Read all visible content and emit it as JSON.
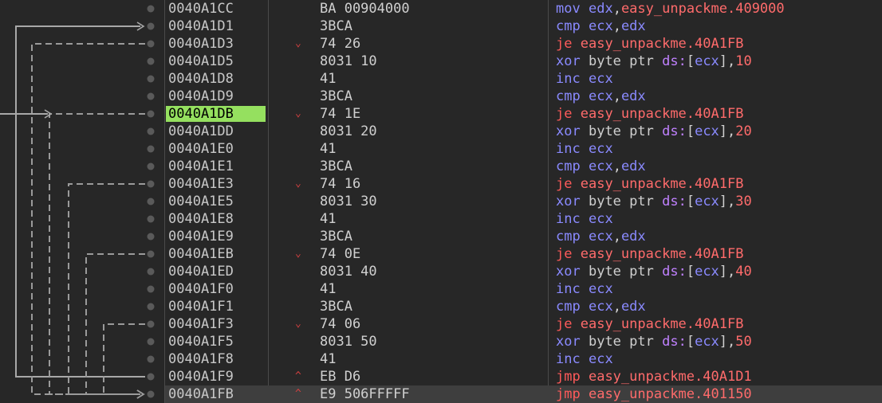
{
  "colors": {
    "background": "#272727",
    "current_row": "#3e3e3e",
    "highlight_address": "#95e05f",
    "arrow": "#9a9a9a",
    "mnemonic_jump": "#ff5a5a",
    "mnemonic_other": "#8a8aff",
    "register": "#8a8aff",
    "label_and_number": "#ff6b6b",
    "segment": "#c081ff"
  },
  "rows": [
    {
      "addr": "0040A1CC",
      "bytes": "BA 00904000",
      "jmark": "",
      "mnemonic": "mov",
      "op_a": "edx",
      "sep": ",",
      "op_b": "easy_unpackme.409000",
      "op_b_kind": "lbl",
      "tail": ""
    },
    {
      "addr": "0040A1D1",
      "bytes": "3BCA",
      "jmark": "",
      "mnemonic": "cmp",
      "op_a": "ecx",
      "sep": ",",
      "op_b": "edx",
      "op_b_kind": "reg",
      "tail": ""
    },
    {
      "addr": "0040A1D3",
      "bytes": "74 26",
      "jmark": "⌄",
      "mnemonic": "je",
      "op_a": "easy_unpackme.40A1FB",
      "sep": "",
      "op_b": "",
      "op_b_kind": "",
      "tail": ""
    },
    {
      "addr": "0040A1D5",
      "bytes": "8031 10",
      "jmark": "",
      "mnemonic": "xor",
      "op_a": "byte ptr",
      "sep": " ",
      "op_b": "ds:",
      "op_b_kind": "seg",
      "tail": "10"
    },
    {
      "addr": "0040A1D8",
      "bytes": "41",
      "jmark": "",
      "mnemonic": "inc",
      "op_a": "ecx",
      "sep": "",
      "op_b": "",
      "op_b_kind": "",
      "tail": ""
    },
    {
      "addr": "0040A1D9",
      "bytes": "3BCA",
      "jmark": "",
      "mnemonic": "cmp",
      "op_a": "ecx",
      "sep": ",",
      "op_b": "edx",
      "op_b_kind": "reg",
      "tail": ""
    },
    {
      "addr": "0040A1DB",
      "bytes": "74 1E",
      "jmark": "⌄",
      "mnemonic": "je",
      "op_a": "easy_unpackme.40A1FB",
      "sep": "",
      "op_b": "",
      "op_b_kind": "",
      "tail": "",
      "highlight": true
    },
    {
      "addr": "0040A1DD",
      "bytes": "8031 20",
      "jmark": "",
      "mnemonic": "xor",
      "op_a": "byte ptr",
      "sep": " ",
      "op_b": "ds:",
      "op_b_kind": "seg",
      "tail": "20"
    },
    {
      "addr": "0040A1E0",
      "bytes": "41",
      "jmark": "",
      "mnemonic": "inc",
      "op_a": "ecx",
      "sep": "",
      "op_b": "",
      "op_b_kind": "",
      "tail": ""
    },
    {
      "addr": "0040A1E1",
      "bytes": "3BCA",
      "jmark": "",
      "mnemonic": "cmp",
      "op_a": "ecx",
      "sep": ",",
      "op_b": "edx",
      "op_b_kind": "reg",
      "tail": ""
    },
    {
      "addr": "0040A1E3",
      "bytes": "74 16",
      "jmark": "⌄",
      "mnemonic": "je",
      "op_a": "easy_unpackme.40A1FB",
      "sep": "",
      "op_b": "",
      "op_b_kind": "",
      "tail": ""
    },
    {
      "addr": "0040A1E5",
      "bytes": "8031 30",
      "jmark": "",
      "mnemonic": "xor",
      "op_a": "byte ptr",
      "sep": " ",
      "op_b": "ds:",
      "op_b_kind": "seg",
      "tail": "30"
    },
    {
      "addr": "0040A1E8",
      "bytes": "41",
      "jmark": "",
      "mnemonic": "inc",
      "op_a": "ecx",
      "sep": "",
      "op_b": "",
      "op_b_kind": "",
      "tail": ""
    },
    {
      "addr": "0040A1E9",
      "bytes": "3BCA",
      "jmark": "",
      "mnemonic": "cmp",
      "op_a": "ecx",
      "sep": ",",
      "op_b": "edx",
      "op_b_kind": "reg",
      "tail": ""
    },
    {
      "addr": "0040A1EB",
      "bytes": "74 0E",
      "jmark": "⌄",
      "mnemonic": "je",
      "op_a": "easy_unpackme.40A1FB",
      "sep": "",
      "op_b": "",
      "op_b_kind": "",
      "tail": ""
    },
    {
      "addr": "0040A1ED",
      "bytes": "8031 40",
      "jmark": "",
      "mnemonic": "xor",
      "op_a": "byte ptr",
      "sep": " ",
      "op_b": "ds:",
      "op_b_kind": "seg",
      "tail": "40"
    },
    {
      "addr": "0040A1F0",
      "bytes": "41",
      "jmark": "",
      "mnemonic": "inc",
      "op_a": "ecx",
      "sep": "",
      "op_b": "",
      "op_b_kind": "",
      "tail": ""
    },
    {
      "addr": "0040A1F1",
      "bytes": "3BCA",
      "jmark": "",
      "mnemonic": "cmp",
      "op_a": "ecx",
      "sep": ",",
      "op_b": "edx",
      "op_b_kind": "reg",
      "tail": ""
    },
    {
      "addr": "0040A1F3",
      "bytes": "74 06",
      "jmark": "⌄",
      "mnemonic": "je",
      "op_a": "easy_unpackme.40A1FB",
      "sep": "",
      "op_b": "",
      "op_b_kind": "",
      "tail": ""
    },
    {
      "addr": "0040A1F5",
      "bytes": "8031 50",
      "jmark": "",
      "mnemonic": "xor",
      "op_a": "byte ptr",
      "sep": " ",
      "op_b": "ds:",
      "op_b_kind": "seg",
      "tail": "50"
    },
    {
      "addr": "0040A1F8",
      "bytes": "41",
      "jmark": "",
      "mnemonic": "inc",
      "op_a": "ecx",
      "sep": "",
      "op_b": "",
      "op_b_kind": "",
      "tail": ""
    },
    {
      "addr": "0040A1F9",
      "bytes": "EB D6",
      "jmark": "^",
      "mnemonic": "jmp",
      "op_a": "easy_unpackme.40A1D1",
      "sep": "",
      "op_b": "",
      "op_b_kind": "",
      "tail": ""
    },
    {
      "addr": "0040A1FB",
      "bytes": "E9 506FFFFF",
      "jmark": "^",
      "mnemonic": "jmp",
      "op_a": "easy_unpackme.401150",
      "sep": "",
      "op_b": "",
      "op_b_kind": "",
      "tail": "",
      "current": true
    }
  ]
}
